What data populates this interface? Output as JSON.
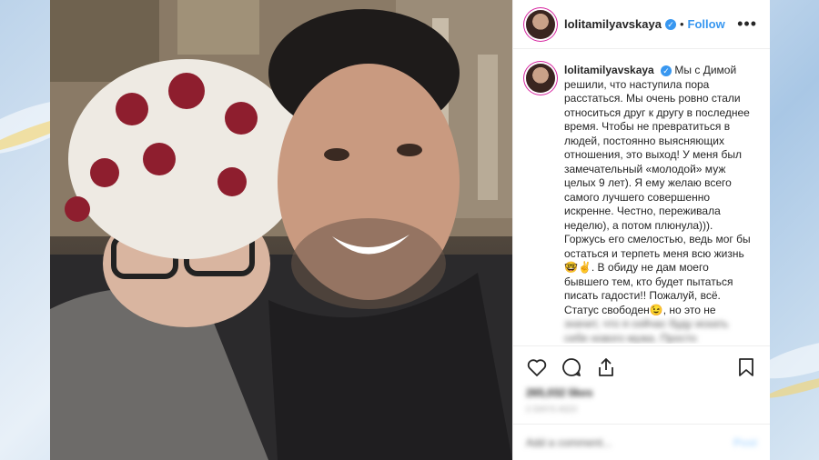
{
  "post": {
    "username": "lolitamilyavskaya",
    "verified_mark": "✓",
    "separator": "•",
    "follow_label": "Follow",
    "more_label": "•••",
    "caption_lines": [
      "Мы с Димой",
      "решили, что наступила пора",
      "расстаться. Мы очень ровно стали",
      "относиться друг к другу в последнее",
      "время. Чтобы не превратиться в",
      "людей, постоянно выясняющих",
      "отношения, это выход! У меня был",
      "замечательный «молодой» муж",
      "целых 9 лет). Я ему желаю всего",
      "самого лучшего совершенно",
      "искренне. Честно, переживала",
      "неделю), а потом плюнула))).",
      "Горжусь его смелостью, ведь мог бы",
      "остаться и терпеть меня всю жизнь",
      "🤓✌. В обиду не дам моего",
      "бывшего тем, кто будет пытаться",
      "писать гадости!! Пожалуй, всё.",
      "Статус свободен😉, но это не",
      "значит, что я сейчас буду искать",
      "себе нового мужа. Просто"
    ],
    "likes": "265,032 likes",
    "timestamp": "2 DAYS AGO",
    "add_comment_placeholder": "Add a comment...",
    "post_label": "Post",
    "icons": [
      "heart-icon",
      "comment-icon",
      "share-icon",
      "bookmark-icon"
    ]
  }
}
